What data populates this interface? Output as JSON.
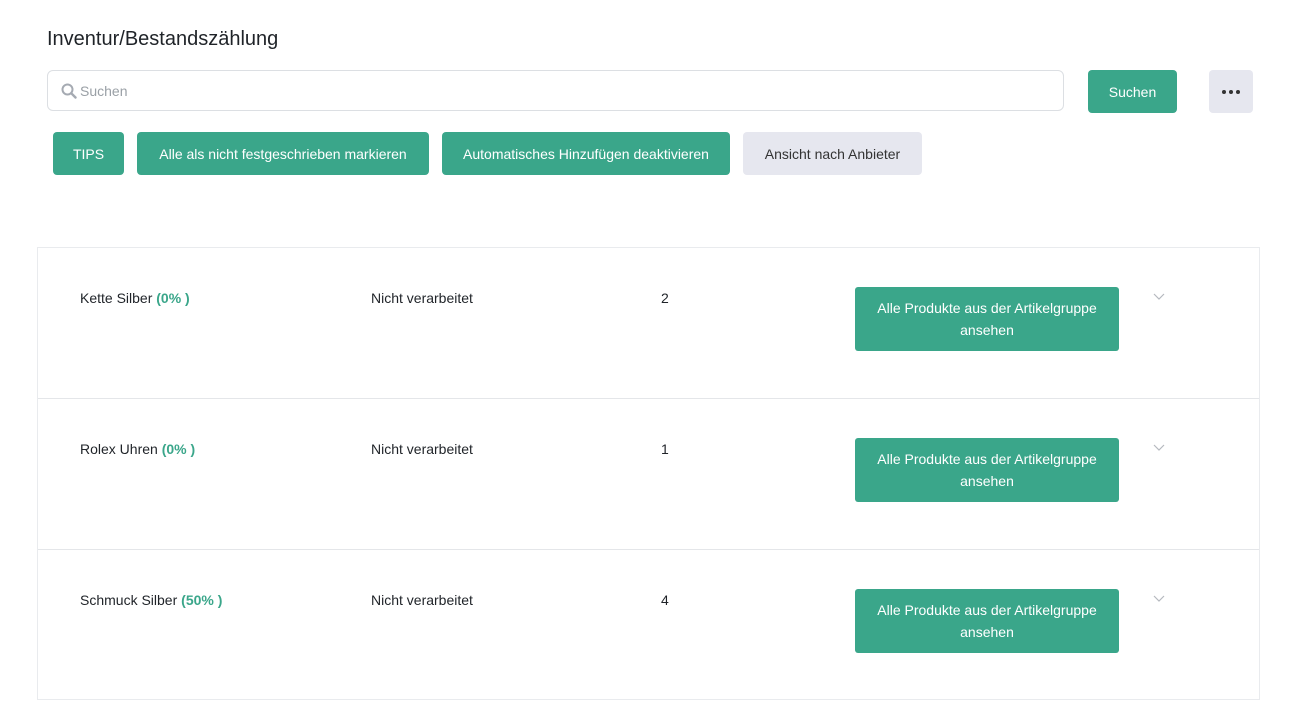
{
  "page": {
    "title": "Inventur/Bestandszählung"
  },
  "search": {
    "placeholder": "Suchen",
    "value": "",
    "button_label": "Suchen"
  },
  "toolbar": {
    "tips_label": "TIPS",
    "mark_all_label": "Alle als nicht festgeschrieben markieren",
    "auto_add_label": "Automatisches Hinzufügen deaktivieren",
    "vendor_view_label": "Ansicht nach Anbieter"
  },
  "colors": {
    "accent": "#3aa68a",
    "secondary_button": "#e6e7ef"
  },
  "groups": [
    {
      "name": "Kette Silber",
      "percent": "(0% )",
      "status": "Nicht verarbeitet",
      "count": "2",
      "action_label": "Alle Produkte aus der Artikelgruppe ansehen"
    },
    {
      "name": "Rolex Uhren",
      "percent": "(0% )",
      "status": "Nicht verarbeitet",
      "count": "1",
      "action_label": "Alle Produkte aus der Artikelgruppe ansehen"
    },
    {
      "name": "Schmuck Silber",
      "percent": "(50% )",
      "status": "Nicht verarbeitet",
      "count": "4",
      "action_label": "Alle Produkte aus der Artikelgruppe ansehen"
    }
  ]
}
